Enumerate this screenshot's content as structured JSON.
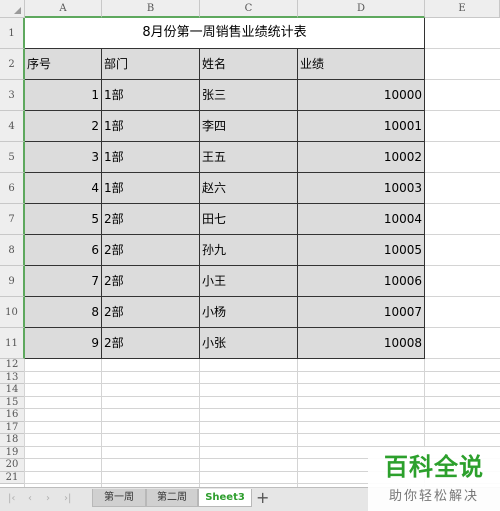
{
  "columns": [
    "A",
    "B",
    "C",
    "D",
    "E"
  ],
  "row_numbers": [
    "1",
    "2",
    "3",
    "4",
    "5",
    "6",
    "7",
    "8",
    "9",
    "10",
    "11",
    "12",
    "13",
    "14",
    "15",
    "16",
    "17",
    "18",
    "19",
    "20",
    "21"
  ],
  "table": {
    "title": "8月份第一周销售业绩统计表",
    "headers": [
      "序号",
      "部门",
      "姓名",
      "业绩"
    ],
    "rows": [
      [
        "1",
        "1部",
        "张三",
        "10000"
      ],
      [
        "2",
        "1部",
        "李四",
        "10001"
      ],
      [
        "3",
        "1部",
        "王五",
        "10002"
      ],
      [
        "4",
        "1部",
        "赵六",
        "10003"
      ],
      [
        "5",
        "2部",
        "田七",
        "10004"
      ],
      [
        "6",
        "2部",
        "孙九",
        "10005"
      ],
      [
        "7",
        "2部",
        "小王",
        "10006"
      ],
      [
        "8",
        "2部",
        "小杨",
        "10007"
      ],
      [
        "9",
        "2部",
        "小张",
        "10008"
      ]
    ]
  },
  "sheet_tabs": {
    "tabs": [
      "第一周",
      "第二周",
      "Sheet3"
    ],
    "active_index": 2,
    "add_label": "+",
    "nav_icons": [
      "first-sheet-icon",
      "prev-sheet-icon",
      "next-sheet-icon",
      "last-sheet-icon"
    ]
  },
  "watermark": {
    "line1": "百科全说",
    "line2": "助你轻松解决"
  },
  "colors": {
    "selection_border": "#5ea85e",
    "table_fill": "#dcdcdc",
    "active_tab_text": "#2e9e2e",
    "watermark_green": "#2ca02c"
  }
}
